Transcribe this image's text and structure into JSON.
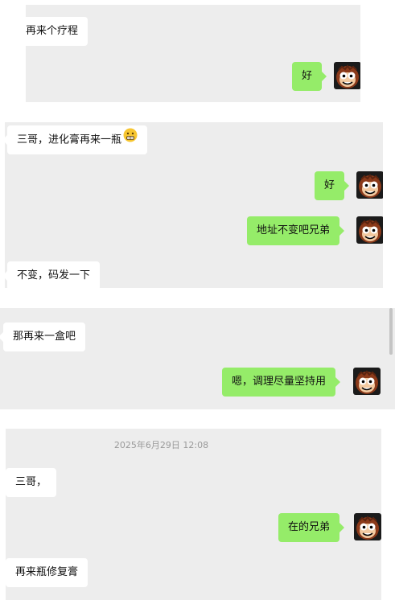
{
  "colors": {
    "panel_bg": "#ededed",
    "outgoing_bubble": "#95ec69",
    "incoming_bubble": "#ffffff",
    "timestamp": "#9a9a9a"
  },
  "avatar_icon": "cartoon-monkey-face-icon",
  "emoji_icon": "grimacing-face-emoji-icon",
  "panel1": {
    "msg_incoming": "再来个疗程",
    "msg_outgoing": "好"
  },
  "panel2": {
    "msg_incoming_1": "三哥，进化膏再来一瓶",
    "msg_outgoing_1": "好",
    "msg_outgoing_2": "地址不变吧兄弟",
    "msg_incoming_2": "不变，码发一下"
  },
  "panel3": {
    "msg_incoming": "那再来一盒吧",
    "msg_outgoing": "嗯，调理尽量坚持用"
  },
  "panel4": {
    "timestamp": "2025年6月29日 12:08",
    "msg_incoming_1": "三哥，",
    "msg_outgoing": "在的兄弟",
    "msg_incoming_2": "再来瓶修复膏"
  }
}
